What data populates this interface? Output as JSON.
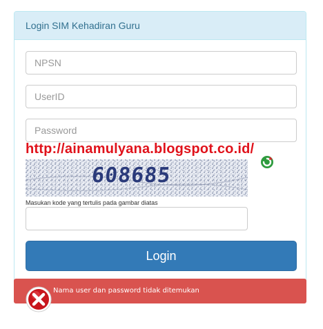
{
  "panel": {
    "title": "Login SIM Kehadiran Guru"
  },
  "form": {
    "npsn_placeholder": "NPSN",
    "userid_placeholder": "UserID",
    "password_placeholder": "Password",
    "captcha_code": "608685",
    "captcha_hint": "Masukan kode yang tertulis pada gambar diatas",
    "captcha_input_placeholder": "",
    "login_label": "Login"
  },
  "watermark": "http://ainamulyana.blogspot.co.id/",
  "alert": {
    "message": "Nama user dan password tidak ditemukan",
    "icon": "close-circle-icon"
  },
  "colors": {
    "panel_heading_bg": "#d9edf7",
    "panel_heading_text": "#31708f",
    "primary": "#337ab7",
    "danger": "#d9534f",
    "watermark": "#e0121b"
  }
}
